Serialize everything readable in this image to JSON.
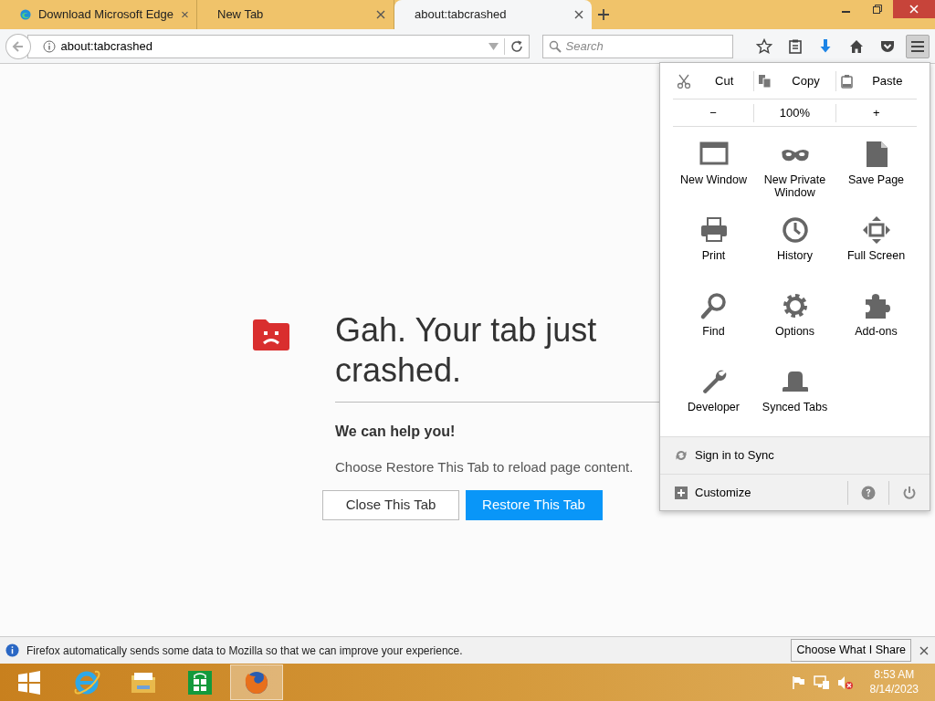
{
  "tabs": [
    {
      "label": "Download Microsoft Edge",
      "favicon": true,
      "selected": false
    },
    {
      "label": "New Tab",
      "favicon": false,
      "selected": false
    },
    {
      "label": "about:tabcrashed",
      "favicon": false,
      "selected": true
    }
  ],
  "toolbar": {
    "url": "about:tabcrashed",
    "search_placeholder": "Search",
    "menu_pressed": true
  },
  "page": {
    "heading": "Gah. Your tab just crashed.",
    "subheading": "We can help you!",
    "message": "Choose Restore This Tab to reload page content.",
    "buttons": [
      {
        "label": "Close This Tab",
        "kind": "secondary"
      },
      {
        "label": "Restore This Tab",
        "kind": "primary"
      }
    ]
  },
  "menu": {
    "edit": [
      "Cut",
      "Copy",
      "Paste"
    ],
    "zoom": {
      "minus": "−",
      "level": "100%",
      "plus": "+"
    },
    "items": [
      "New Window",
      "New Private Window",
      "Save Page",
      "Print",
      "History",
      "Full Screen",
      "Find",
      "Options",
      "Add-ons",
      "Developer",
      "Synced Tabs"
    ],
    "sign_in": "Sign in to Sync",
    "customize": "Customize"
  },
  "notification": {
    "text": "Firefox automatically sends some data to Mozilla so that we can improve your experience.",
    "button": "Choose What I Share"
  },
  "taskbar": {
    "apps": [
      {
        "selected": false
      },
      {
        "selected": false
      },
      {
        "selected": false
      },
      {
        "selected": false
      },
      {
        "selected": true
      }
    ],
    "time": "8:53 AM",
    "date": "8/14/2023"
  }
}
